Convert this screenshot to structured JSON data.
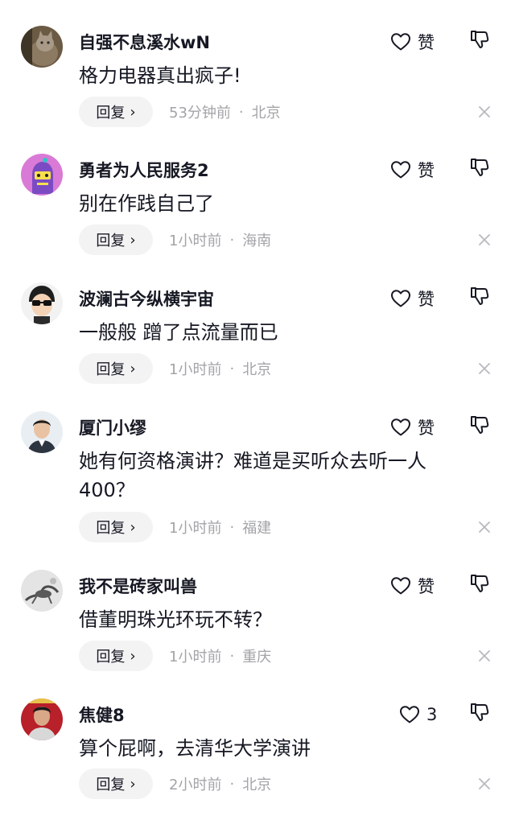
{
  "colors": {
    "text": "#161823",
    "meta": "#a3a4a8",
    "pill": "#f3f3f4"
  },
  "icons": {
    "like": "heart-outline-icon",
    "dislike": "thumbs-down-icon",
    "close": "close-x-icon",
    "chevron": "chevron-right-icon"
  },
  "comments": [
    {
      "username": "自强不息溪水wN",
      "text": "格力电器真出疯子!",
      "like_label": "赞",
      "reply_label": "回复",
      "time": "53分钟前",
      "location": "北京"
    },
    {
      "username": "勇者为人民服务2",
      "text": "别在作践自己了",
      "like_label": "赞",
      "reply_label": "回复",
      "time": "1小时前",
      "location": "海南"
    },
    {
      "username": "波澜古今纵横宇宙",
      "text": "一般般 蹭了点流量而已",
      "like_label": "赞",
      "reply_label": "回复",
      "time": "1小时前",
      "location": "北京"
    },
    {
      "username": "厦门小缪",
      "text": "她有何资格演讲？难道是买听众去听一人400？",
      "like_label": "赞",
      "reply_label": "回复",
      "time": "1小时前",
      "location": "福建"
    },
    {
      "username": "我不是砖家叫兽",
      "text": "借董明珠光环玩不转？",
      "like_label": "赞",
      "reply_label": "回复",
      "time": "1小时前",
      "location": "重庆"
    },
    {
      "username": "焦健8",
      "text": "算个屁啊，去清华大学演讲",
      "like_label": "3",
      "reply_label": "回复",
      "time": "2小时前",
      "location": "北京"
    }
  ]
}
